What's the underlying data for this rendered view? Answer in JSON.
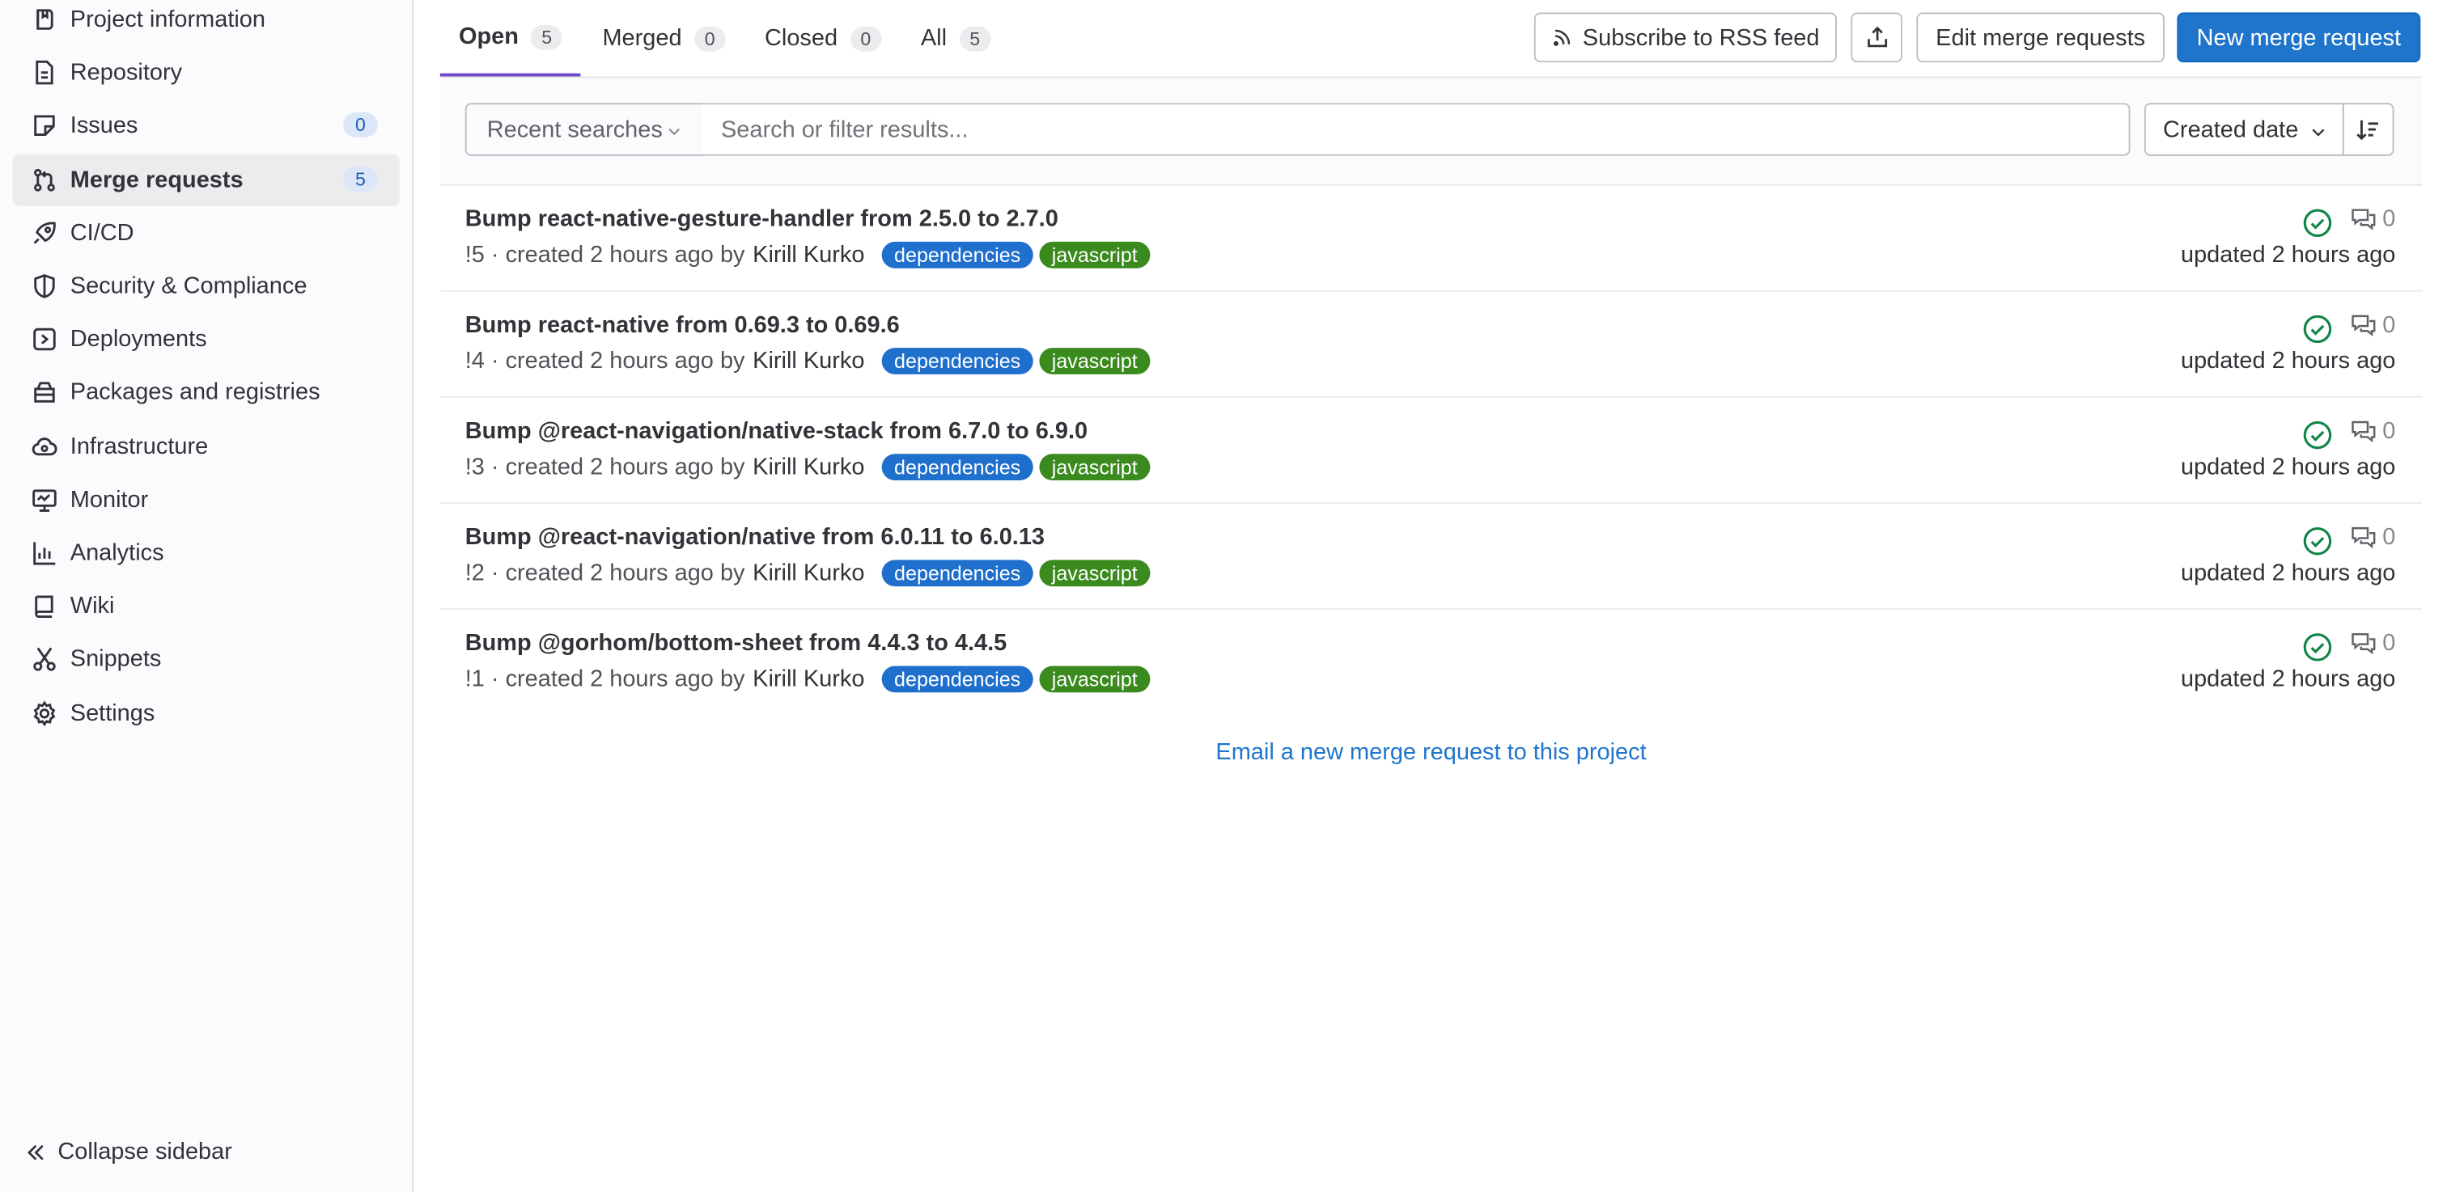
{
  "sidebar": {
    "items": [
      {
        "label": "Project information",
        "icon": "project-icon"
      },
      {
        "label": "Repository",
        "icon": "doc-icon"
      },
      {
        "label": "Issues",
        "icon": "issues-icon",
        "badge": "0"
      },
      {
        "label": "Merge requests",
        "icon": "merge-request-icon",
        "badge": "5",
        "active": true
      },
      {
        "label": "CI/CD",
        "icon": "rocket-icon"
      },
      {
        "label": "Security & Compliance",
        "icon": "shield-icon"
      },
      {
        "label": "Deployments",
        "icon": "deployments-icon"
      },
      {
        "label": "Packages and registries",
        "icon": "package-icon"
      },
      {
        "label": "Infrastructure",
        "icon": "cloud-gear-icon"
      },
      {
        "label": "Monitor",
        "icon": "monitor-icon"
      },
      {
        "label": "Analytics",
        "icon": "chart-icon"
      },
      {
        "label": "Wiki",
        "icon": "book-icon"
      },
      {
        "label": "Snippets",
        "icon": "scissors-icon"
      },
      {
        "label": "Settings",
        "icon": "gear-icon"
      }
    ],
    "collapse_label": "Collapse sidebar"
  },
  "tabs": [
    {
      "label": "Open",
      "count": "5",
      "active": true
    },
    {
      "label": "Merged",
      "count": "0"
    },
    {
      "label": "Closed",
      "count": "0"
    },
    {
      "label": "All",
      "count": "5"
    }
  ],
  "actions": {
    "rss_label": "Subscribe to RSS feed",
    "edit_label": "Edit merge requests",
    "new_label": "New merge request"
  },
  "filter": {
    "recent_label": "Recent searches",
    "search_placeholder": "Search or filter results...",
    "sort_label": "Created date"
  },
  "merge_requests": [
    {
      "title": "Bump react-native-gesture-handler from 2.5.0 to 2.7.0",
      "ref": "!5",
      "created": "· created 2 hours ago by",
      "author": "Kirill Kurko",
      "labels": [
        "dependencies",
        "javascript"
      ],
      "comments": "0",
      "updated": "updated 2 hours ago"
    },
    {
      "title": "Bump react-native from 0.69.3 to 0.69.6",
      "ref": "!4",
      "created": "· created 2 hours ago by",
      "author": "Kirill Kurko",
      "labels": [
        "dependencies",
        "javascript"
      ],
      "comments": "0",
      "updated": "updated 2 hours ago"
    },
    {
      "title": "Bump @react-navigation/native-stack from 6.7.0 to 6.9.0",
      "ref": "!3",
      "created": "· created 2 hours ago by",
      "author": "Kirill Kurko",
      "labels": [
        "dependencies",
        "javascript"
      ],
      "comments": "0",
      "updated": "updated 2 hours ago"
    },
    {
      "title": "Bump @react-navigation/native from 6.0.11 to 6.0.13",
      "ref": "!2",
      "created": "· created 2 hours ago by",
      "author": "Kirill Kurko",
      "labels": [
        "dependencies",
        "javascript"
      ],
      "comments": "0",
      "updated": "updated 2 hours ago"
    },
    {
      "title": "Bump @gorhom/bottom-sheet from 4.4.3 to 4.4.5",
      "ref": "!1",
      "created": "· created 2 hours ago by",
      "author": "Kirill Kurko",
      "labels": [
        "dependencies",
        "javascript"
      ],
      "comments": "0",
      "updated": "updated 2 hours ago"
    }
  ],
  "email_link": "Email a new merge request to this project",
  "colors": {
    "primary": "#1f75cb",
    "label_dependencies": "#1f6fcd",
    "label_javascript": "#3a8a1e",
    "pipeline_success": "#108548",
    "active_tab": "#6e49cb"
  }
}
